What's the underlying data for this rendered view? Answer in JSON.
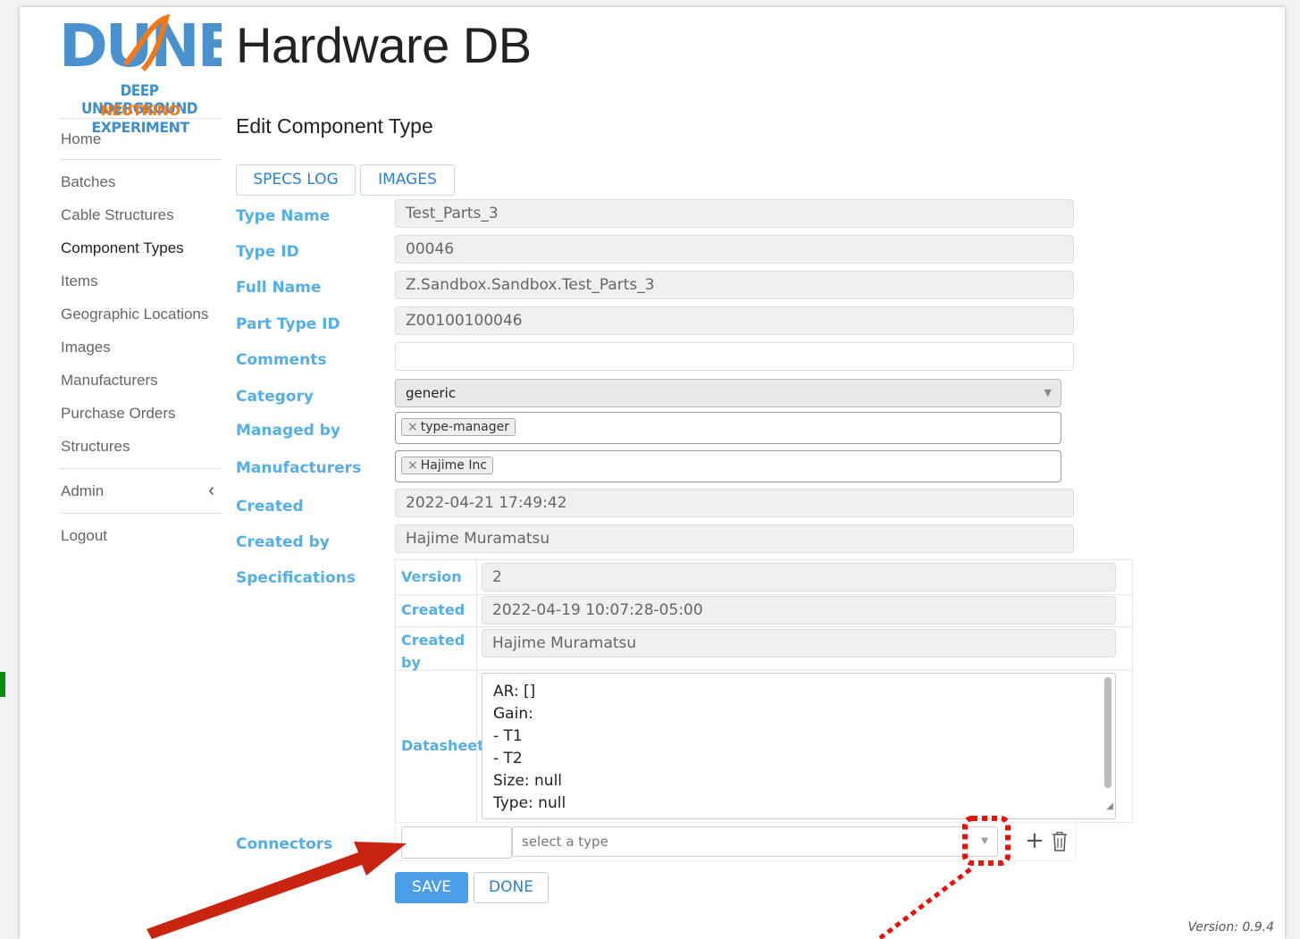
{
  "app": {
    "title": "Hardware DB",
    "logo_text": "DUNE",
    "logo_line1": "DEEP UNDERGROUND",
    "logo_line2_a": "NEUTRINO",
    "logo_line2_b": " EXPERIMENT"
  },
  "sidebar": {
    "items": [
      {
        "label": "Home"
      },
      {
        "label": "Batches"
      },
      {
        "label": "Cable Structures"
      },
      {
        "label": "Component Types"
      },
      {
        "label": "Items"
      },
      {
        "label": "Geographic Locations"
      },
      {
        "label": "Images"
      },
      {
        "label": "Manufacturers"
      },
      {
        "label": "Purchase Orders"
      },
      {
        "label": "Structures"
      },
      {
        "label": "Admin"
      },
      {
        "label": "Logout"
      }
    ],
    "admin_chevron": "‹"
  },
  "page": {
    "title": "Edit Component Type",
    "tabs": [
      {
        "label": "SPECS LOG"
      },
      {
        "label": "IMAGES"
      }
    ]
  },
  "form": {
    "type_name": {
      "label": "Type Name",
      "value": "Test_Parts_3"
    },
    "type_id": {
      "label": "Type ID",
      "value": "00046"
    },
    "full_name": {
      "label": "Full Name",
      "value": "Z.Sandbox.Sandbox.Test_Parts_3"
    },
    "part_type_id": {
      "label": "Part Type ID",
      "value": "Z00100100046"
    },
    "comments": {
      "label": "Comments",
      "value": ""
    },
    "category": {
      "label": "Category",
      "value": "generic"
    },
    "managed_by": {
      "label": "Managed by",
      "tag": "type-manager"
    },
    "manufacturers": {
      "label": "Manufacturers",
      "tag": "Hajime Inc"
    },
    "created": {
      "label": "Created",
      "value": "2022-04-21 17:49:42"
    },
    "created_by": {
      "label": "Created by",
      "value": "Hajime Muramatsu"
    },
    "specifications": {
      "label": "Specifications",
      "version_label": "Version",
      "version": "2",
      "created_label": "Created",
      "created": "2022-04-19 10:07:28-05:00",
      "created_by_label_1": "Created",
      "created_by_label_2": "by",
      "created_by": "Hajime Muramatsu",
      "datasheet_label": "Datasheet",
      "datasheet_lines": [
        "AR: []",
        "Gain:",
        "- T1",
        "- T2",
        "Size: null",
        "Type: null"
      ]
    },
    "connectors": {
      "label": "Connectors",
      "placeholder": "select a type",
      "add": "+"
    }
  },
  "actions": {
    "save": "SAVE",
    "done": "DONE"
  },
  "footer": {
    "version": "Version: 0.9.4"
  },
  "colors": {
    "label_blue": "#55aee8",
    "button_blue": "#4a9ee8",
    "annotation_red": "#c8240f",
    "annotation_dots": "#e8120c"
  }
}
